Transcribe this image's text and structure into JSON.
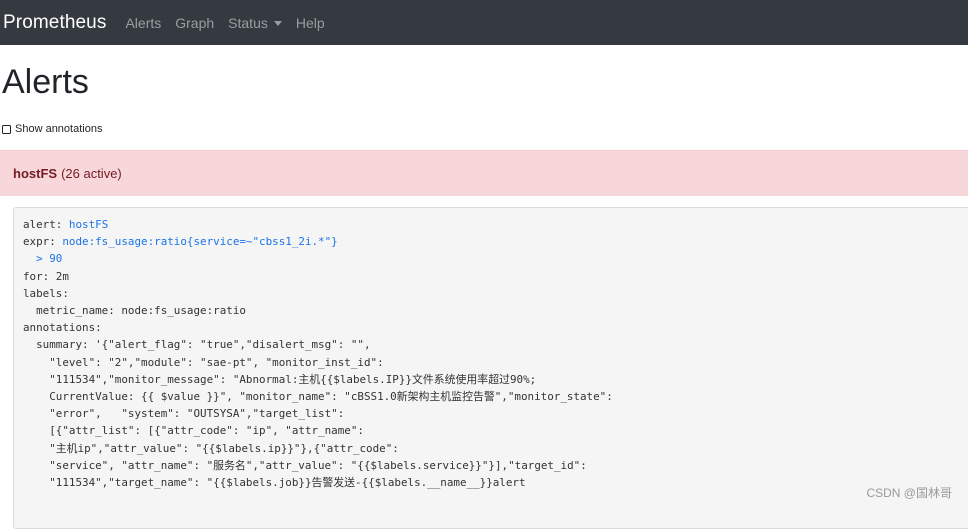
{
  "navbar": {
    "brand": "Prometheus",
    "items": [
      "Alerts",
      "Graph",
      "Status",
      "Help"
    ]
  },
  "page": {
    "title": "Alerts",
    "show_annotations": "Show annotations"
  },
  "alert_group": {
    "name": "hostFS",
    "count": "(26 active)"
  },
  "rule": {
    "lines": [
      {
        "key": "alert: ",
        "value": "hostFS"
      },
      {
        "key": "expr: ",
        "value": "node:fs_usage:ratio{service=~\"cbss1_2i.*\"}"
      },
      {
        "key": "  ",
        "value": "> 90"
      },
      {
        "key": "for: 2m",
        "value": ""
      },
      {
        "key": "labels:",
        "value": ""
      },
      {
        "key": "  metric_name: node:fs_usage:ratio",
        "value": ""
      },
      {
        "key": "annotations:",
        "value": ""
      },
      {
        "key": "  summary: '{\"alert_flag\": \"true\",\"disalert_msg\": \"\",",
        "value": ""
      },
      {
        "key": "    \"level\": \"2\",\"module\": \"sae-pt\", \"monitor_inst_id\":",
        "value": ""
      },
      {
        "key": "    \"111534\",\"monitor_message\": \"Abnormal:主机{{$labels.IP}}文件系统使用率超过90%;",
        "value": ""
      },
      {
        "key": "    CurrentValue: {{ $value }}\", \"monitor_name\": \"cBSS1.0新架构主机监控告警\",\"monitor_state\":",
        "value": ""
      },
      {
        "key": "    \"error\",   \"system\": \"OUTSYSA\",\"target_list\":",
        "value": ""
      },
      {
        "key": "    [{\"attr_list\": [{\"attr_code\": \"ip\", \"attr_name\":",
        "value": ""
      },
      {
        "key": "    \"主机ip\",\"attr_value\": \"{{$labels.ip}}\"},{\"attr_code\":",
        "value": ""
      },
      {
        "key": "    \"service\", \"attr_name\": \"服务名\",\"attr_value\": \"{{$labels.service}}\"}],\"target_id\":",
        "value": ""
      },
      {
        "key": "    \"111534\",\"target_name\": \"{{$labels.job}}告警发送-{{$labels.__name__}}alert",
        "value": ""
      }
    ]
  },
  "watermark": "CSDN @国林哥",
  "colors": {
    "navbar": "#343a40",
    "alert_bg": "#f8d7da",
    "alert_text": "#721c24",
    "code_bg": "#f5f5f5",
    "highlight": "#1a73e8"
  }
}
